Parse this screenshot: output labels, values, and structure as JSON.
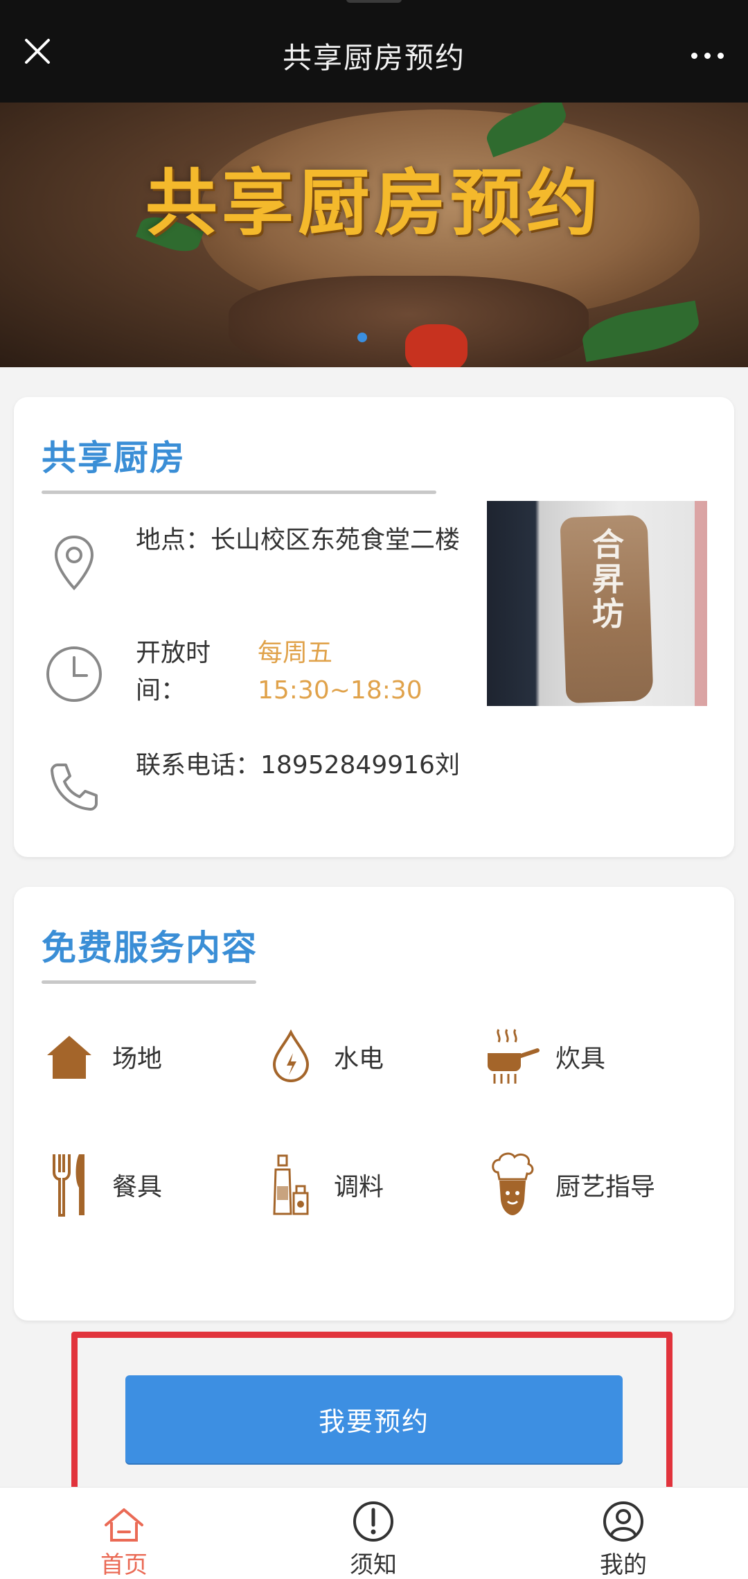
{
  "header": {
    "title": "共享厨房预约",
    "close_icon": "close-icon",
    "more_icon": "more-icon"
  },
  "banner": {
    "title": "共享厨房预约",
    "active_slide": 1
  },
  "kitchen_card": {
    "title": "共享厨房",
    "location": "地点：长山校区东苑食堂二楼",
    "hours_label": "开放时间：",
    "hours_day": "每周五",
    "hours_time": "15:30~18:30",
    "phone": "联系电话：18952849916刘",
    "photo_sign": "合\n昇\n坊"
  },
  "services_card": {
    "title": "免费服务内容",
    "items": [
      {
        "label": "场地",
        "icon": "house-icon"
      },
      {
        "label": "水电",
        "icon": "water-drop-icon"
      },
      {
        "label": "炊具",
        "icon": "pot-icon"
      },
      {
        "label": "餐具",
        "icon": "cutlery-icon"
      },
      {
        "label": "调料",
        "icon": "condiment-icon"
      },
      {
        "label": "厨艺指导",
        "icon": "chef-icon"
      }
    ]
  },
  "booking": {
    "button_label": "我要预约"
  },
  "tabbar": {
    "tabs": [
      {
        "label": "首页",
        "icon": "home-icon",
        "active": true
      },
      {
        "label": "须知",
        "icon": "notice-icon",
        "active": false
      },
      {
        "label": "我的",
        "icon": "user-icon",
        "active": false
      }
    ]
  },
  "colors": {
    "accent_blue": "#3a8ed6",
    "button_blue": "#3d8fe2",
    "hours_orange": "#e0a24a",
    "icon_brown": "#a4652a",
    "active_tab": "#ea6a55",
    "highlight_red": "#e1333c"
  }
}
